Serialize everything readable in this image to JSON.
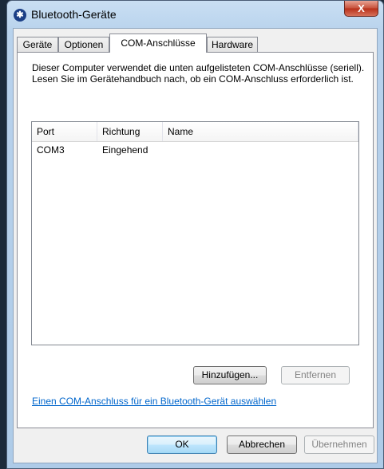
{
  "window": {
    "title": "Bluetooth-Geräte",
    "close_label": "X",
    "bt_glyph": "ʙ"
  },
  "tabs": [
    {
      "label": "Geräte"
    },
    {
      "label": "Optionen"
    },
    {
      "label": "COM-Anschlüsse",
      "active": true
    },
    {
      "label": "Hardware"
    }
  ],
  "panel": {
    "description": "Dieser Computer verwendet die unten aufgelisteten COM-Anschlüsse (seriell). Lesen Sie im Gerätehandbuch nach, ob ein COM-Anschluss erforderlich ist.",
    "columns": [
      "Port",
      "Richtung",
      "Name"
    ],
    "rows": [
      {
        "port": "COM3",
        "richtung": "Eingehend",
        "name": ""
      }
    ],
    "add_button": "Hinzufügen...",
    "remove_button": "Entfernen",
    "link": "Einen COM-Anschluss für ein Bluetooth-Gerät auswählen"
  },
  "footer": {
    "ok": "OK",
    "cancel": "Abbrechen",
    "apply": "Übernehmen"
  }
}
